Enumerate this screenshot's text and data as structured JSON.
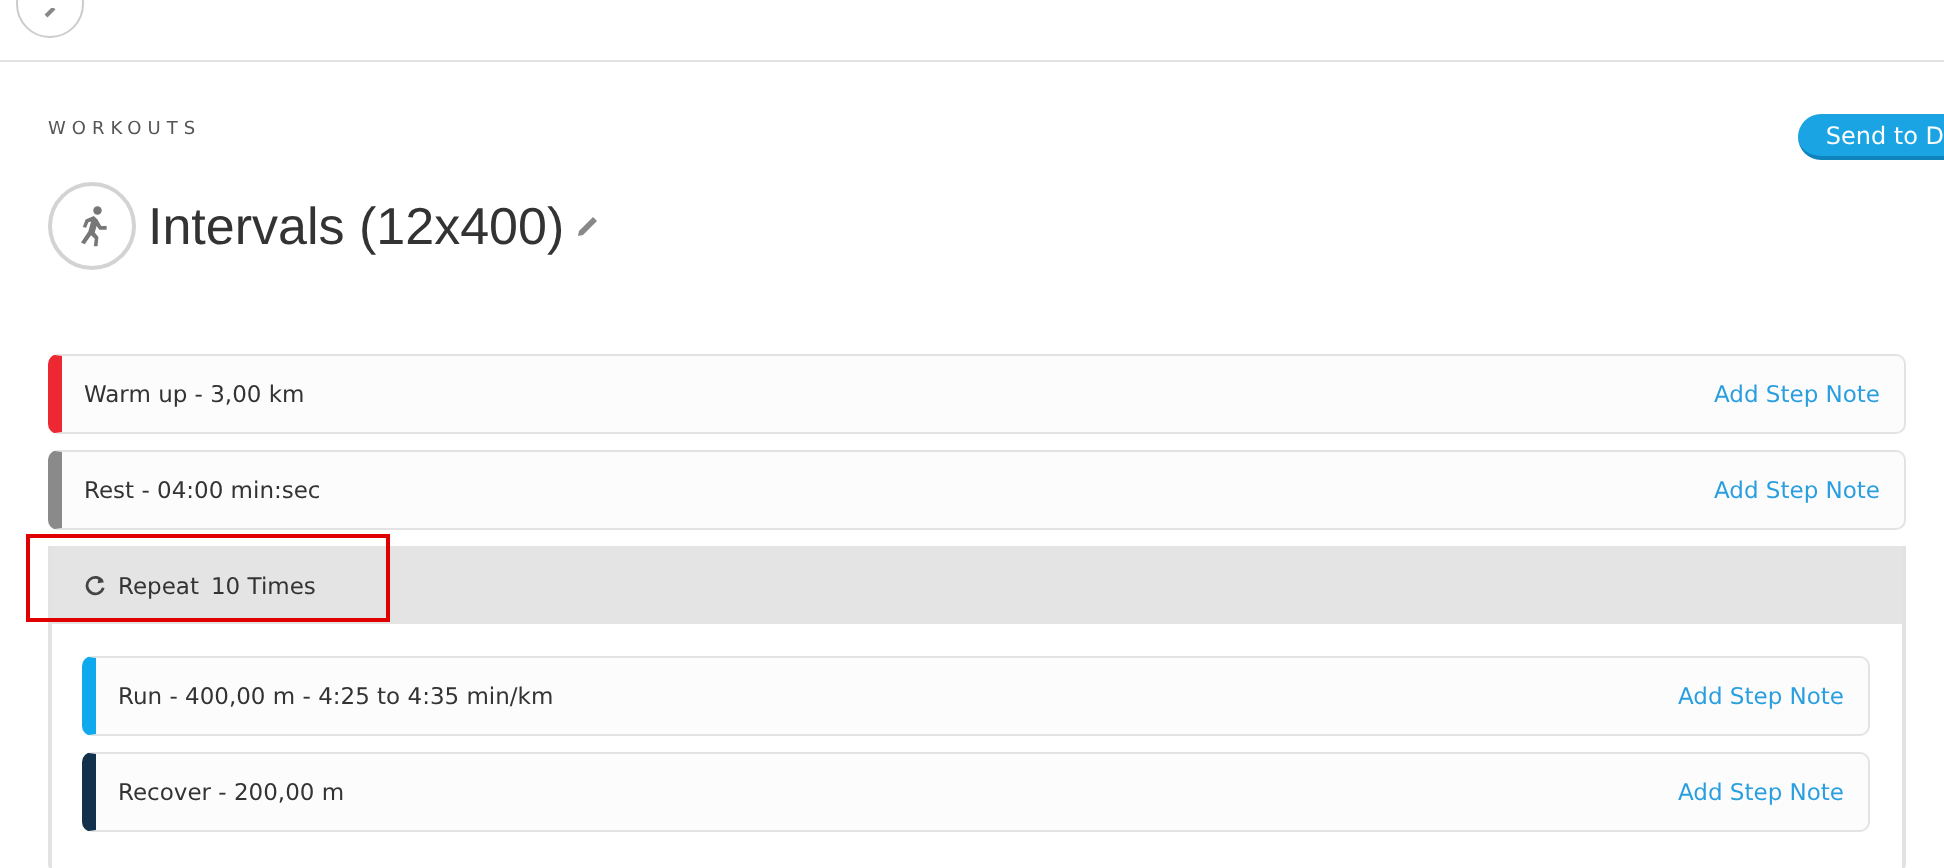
{
  "breadcrumb": "WORKOUTS",
  "title": "Intervals (12x400)",
  "send_button": "Send to D",
  "steps": [
    {
      "kind": "step",
      "label": "Warm up - 3,00 km",
      "color": "#ee2833",
      "note_link": "Add Step Note"
    },
    {
      "kind": "step",
      "label": "Rest - 04:00 min:sec",
      "color": "#8a8a8a",
      "note_link": "Add Step Note"
    },
    {
      "kind": "repeat",
      "label": "Repeat",
      "count": "10 Times",
      "highlighted": true,
      "children": [
        {
          "kind": "step",
          "label": "Run - 400,00 m - 4:25 to 4:35 min/km",
          "color": "#11a9ed",
          "note_link": "Add Step Note"
        },
        {
          "kind": "step",
          "label": "Recover - 200,00 m",
          "color": "#12314d",
          "note_link": "Add Step Note"
        }
      ]
    }
  ]
}
